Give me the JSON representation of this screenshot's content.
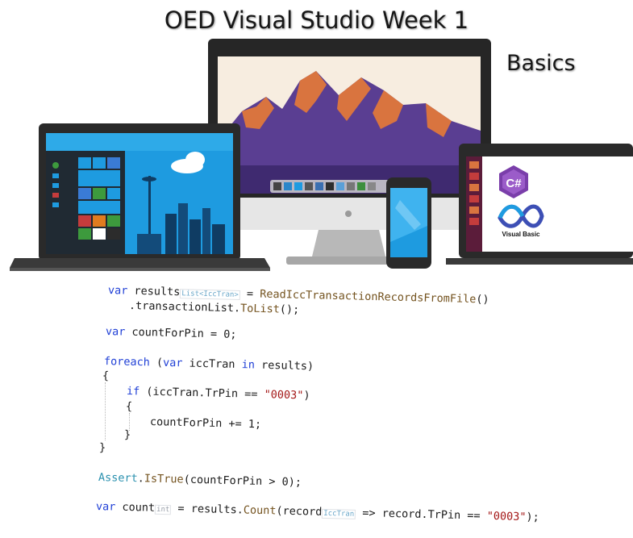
{
  "title": "OED Visual Studio Week 1",
  "subtitle": "Basics",
  "logos": {
    "csharp_glyph": "C#",
    "vb_label": "Visual Basic"
  },
  "code": {
    "l1": {
      "kw": "var",
      "name": "results",
      "hint": "List<IccTran>",
      "mid": " = ",
      "fn": "ReadIccTransactionRecordsFromFile",
      "end": "()"
    },
    "l2": {
      "pre": ".transactionList.",
      "fn": "ToList",
      "end": "();"
    },
    "l3": {
      "kw": "var",
      "rest": " countForPin = 0;"
    },
    "l4": {
      "kw": "foreach",
      "a": " (",
      "kw2": "var",
      "b": " iccTran ",
      "kw3": "in",
      "c": " results)"
    },
    "l5": "{",
    "l6": {
      "kw": "if",
      "a": " (iccTran.TrPin == ",
      "st": "\"0003\"",
      "b": ")"
    },
    "l7": "{",
    "l8": "countForPin += 1;",
    "l9": "}",
    "l10": "}",
    "l11": {
      "ty": "Assert",
      "a": ".",
      "fn": "IsTrue",
      "b": "(countForPin > 0);"
    },
    "l12": {
      "kw": "var",
      "name": "count",
      "hint": "int",
      "a": " = results.",
      "fn": "Count",
      "b": "(record",
      "hint2": "IccTran",
      "c": " => record.TrPin == ",
      "st": "\"0003\"",
      "d": ");"
    }
  },
  "colors": {
    "win_blue": "#1e9be0",
    "mountain_purple": "#5a3e92",
    "mountain_orange": "#d9743f",
    "ubuntu_purple": "#5b1c3a",
    "device_dark": "#2a2a2a",
    "stand_gray": "#b8b8b8"
  }
}
